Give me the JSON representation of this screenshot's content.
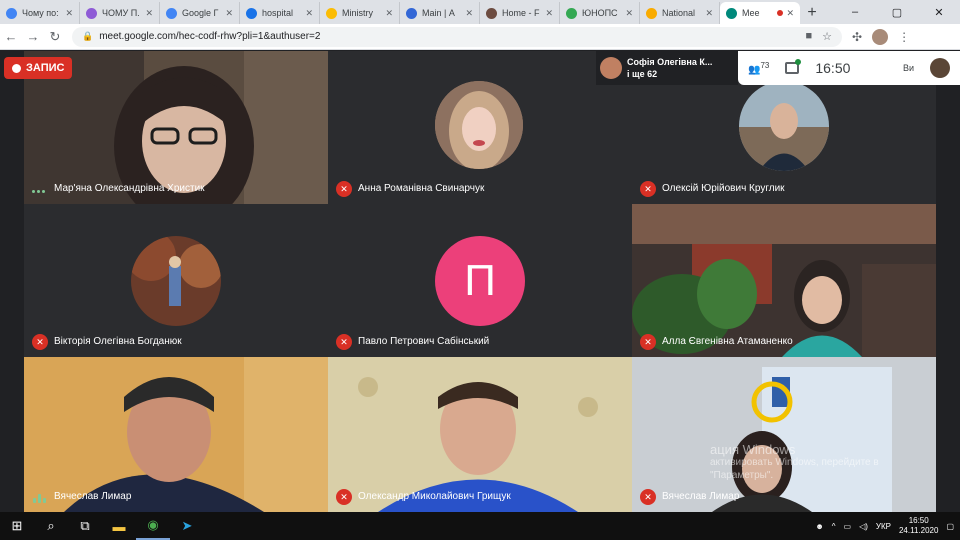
{
  "browser": {
    "tabs": [
      {
        "label": "Чому по:",
        "color": "#4285f4"
      },
      {
        "label": "ЧОМУ П.",
        "color": "#8e5bd6"
      },
      {
        "label": "Google Г",
        "color": "#4285f4"
      },
      {
        "label": "hospital",
        "color": "#1a73e8"
      },
      {
        "label": "Ministry",
        "color": "#fbbc04"
      },
      {
        "label": "Main | А",
        "color": "#3367d6"
      },
      {
        "label": "Home - F",
        "color": "#6d4c41"
      },
      {
        "label": "ЮНОПС",
        "color": "#34a853"
      },
      {
        "label": "National",
        "color": "#f9ab00"
      },
      {
        "label": "Mee",
        "color": "#00897b"
      }
    ],
    "active_tab_index": 9,
    "new_tab": "+",
    "url": "meet.google.com/hec-codf-rhw?pli=1&authuser=2",
    "window_controls": [
      "–",
      "▢",
      "✕"
    ]
  },
  "meet": {
    "recording_label": "ЗАПИС",
    "presenter_name": "Софія Олегівна К...",
    "presenter_more": "і ще 62",
    "participant_count": "73",
    "time": "16:50",
    "you_label": "Ви",
    "tiles": [
      {
        "name": "Мар'яна Олександрівна Христик",
        "status": "speaking"
      },
      {
        "name": "Анна Романівна Свинарчук",
        "status": "muted"
      },
      {
        "name": "Олексій Юрійович Круглик",
        "status": "muted"
      },
      {
        "name": "Вікторія Олегівна Богданюк",
        "status": "muted"
      },
      {
        "name": "Павло Петрович Сабінський",
        "status": "muted",
        "letter": "П"
      },
      {
        "name": "Алла Євгенівна Атаманенко",
        "status": "muted"
      },
      {
        "name": "Вячеслав Лимар",
        "status": "level"
      },
      {
        "name": "Олександр Миколайович Грищук",
        "status": "muted"
      },
      {
        "name": "Вячеслав Лимар",
        "status": "muted"
      }
    ],
    "watermark_line1": "ация Windows",
    "watermark_line2": "активировать Windows, перейдите в",
    "watermark_line3": "\"Параметры\"."
  },
  "taskbar": {
    "language": "УКР",
    "clock_time": "16:50",
    "clock_date": "24.11.2020"
  }
}
